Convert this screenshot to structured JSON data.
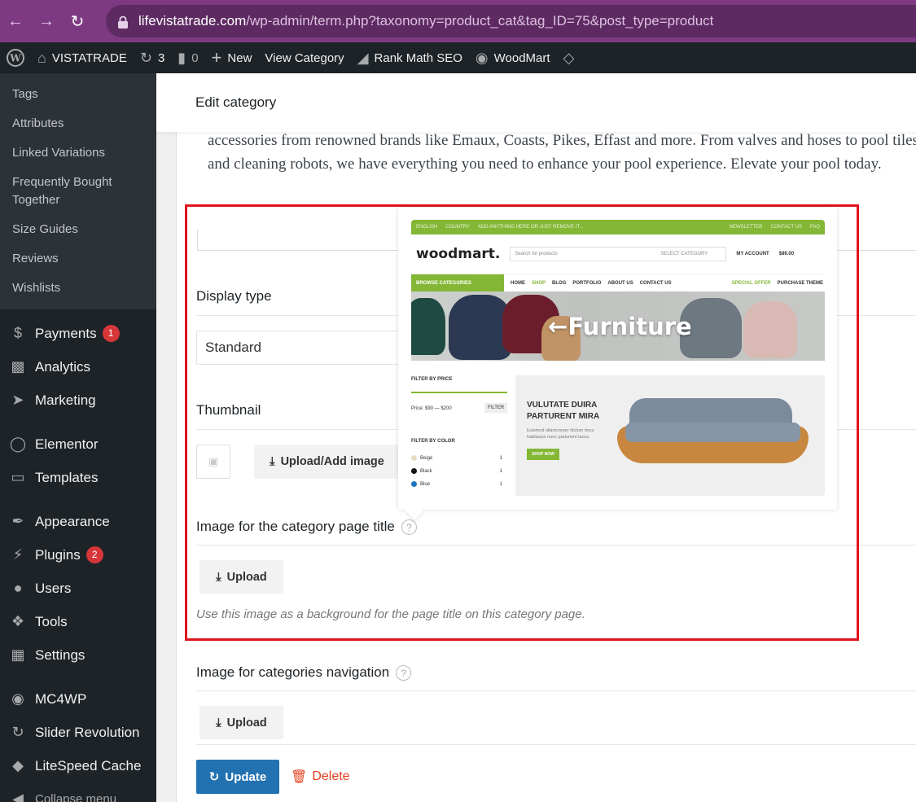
{
  "browser": {
    "url_host": "lifevistatrade.com",
    "url_path": "/wp-admin/term.php?taxonomy=product_cat&tag_ID=75&post_type=product"
  },
  "adminbar": {
    "site_name": "VISTATRADE",
    "updates_count": "3",
    "comments_count": "0",
    "new_label": "New",
    "view_label": "View Category",
    "rankmath_label": "Rank Math SEO",
    "woodmart_label": "WoodMart"
  },
  "sidebar": {
    "submenu": [
      "Tags",
      "Attributes",
      "Linked Variations",
      "Frequently Bought Together",
      "Size Guides",
      "Reviews",
      "Wishlists"
    ],
    "items": [
      {
        "label": "Payments",
        "icon": "dollar-icon",
        "badge": "1"
      },
      {
        "label": "Analytics",
        "icon": "bar-chart-icon",
        "badge": ""
      },
      {
        "label": "Marketing",
        "icon": "megaphone-icon",
        "badge": ""
      },
      {
        "label": "Elementor",
        "icon": "elementor-icon",
        "badge": ""
      },
      {
        "label": "Templates",
        "icon": "folder-icon",
        "badge": ""
      },
      {
        "label": "Appearance",
        "icon": "brush-icon",
        "badge": ""
      },
      {
        "label": "Plugins",
        "icon": "plug-icon",
        "badge": "2"
      },
      {
        "label": "Users",
        "icon": "user-icon",
        "badge": ""
      },
      {
        "label": "Tools",
        "icon": "wrench-icon",
        "badge": ""
      },
      {
        "label": "Settings",
        "icon": "settings-icon",
        "badge": ""
      },
      {
        "label": "MC4WP",
        "icon": "mc4wp-icon",
        "badge": ""
      },
      {
        "label": "Slider Revolution",
        "icon": "refresh-icon",
        "badge": ""
      },
      {
        "label": "LiteSpeed Cache",
        "icon": "diamond-icon",
        "badge": ""
      }
    ],
    "collapse_label": "Collapse menu"
  },
  "page": {
    "title": "Edit category",
    "description": "accessories from renowned brands like Emaux, Coasts, Pikes, Effast and more. From valves and hoses to pool tiles and cleaning robots, we have everything you need to enhance your pool experience. Elevate your pool today.",
    "display_type_label": "Display type",
    "display_type_value": "Standard",
    "thumbnail_label": "Thumbnail",
    "upload_add_label": "Upload/Add image",
    "title_image_label": "Image for the category page title",
    "upload_label": "Upload",
    "title_image_hint": "Use this image as a background for the page title on this category page.",
    "nav_image_label": "Image for categories navigation",
    "upload_label_2": "Upload",
    "update_label": "Update",
    "delete_label": "Delete"
  },
  "preview": {
    "logo": "woodmart.",
    "top_strip": [
      "ENGLISH",
      "COUNTRY",
      "ADD ANYTHING HERE OR JUST REMOVE IT..."
    ],
    "top_right": [
      "NEWSLETTER",
      "CONTACT US",
      "FAQ"
    ],
    "search_placeholder": "Search for products",
    "search_category": "SELECT CATEGORY",
    "account": "MY ACCOUNT",
    "cart_total": "$89.00",
    "browse_categories": "BROWSE CATEGORIES",
    "nav": [
      "HOME",
      "SHOP",
      "BLOG",
      "PORTFOLIO",
      "ABOUT US",
      "CONTACT US"
    ],
    "special_offer": "SPECIAL OFFER",
    "purchase_theme": "PURCHASE THEME",
    "hero_title": "Furniture",
    "filter_price": "FILTER BY PRICE",
    "price_range": "Price: $90 — $200",
    "filter_btn": "FILTER",
    "filter_color": "FILTER BY COLOR",
    "colors": [
      {
        "name": "Beige",
        "count": "1",
        "hex": "#e8dcc0"
      },
      {
        "name": "Black",
        "count": "1",
        "hex": "#111111"
      },
      {
        "name": "Blue",
        "count": "1",
        "hex": "#1e73be"
      }
    ],
    "banner_title": "VULUTATE DUIRA PARTURENT MIRA",
    "banner_sub": "Euismod ullamcorper dictum tincu habitasse nunc parturient lacus.",
    "banner_btn": "SHOP NOW"
  },
  "colors": {
    "browser_bar": "#7d3a83",
    "admin_bg": "#1d2327",
    "primary": "#2271b1",
    "delete": "#e2401c",
    "highlight": "#e0141e",
    "woodmart_green": "#83b735"
  }
}
